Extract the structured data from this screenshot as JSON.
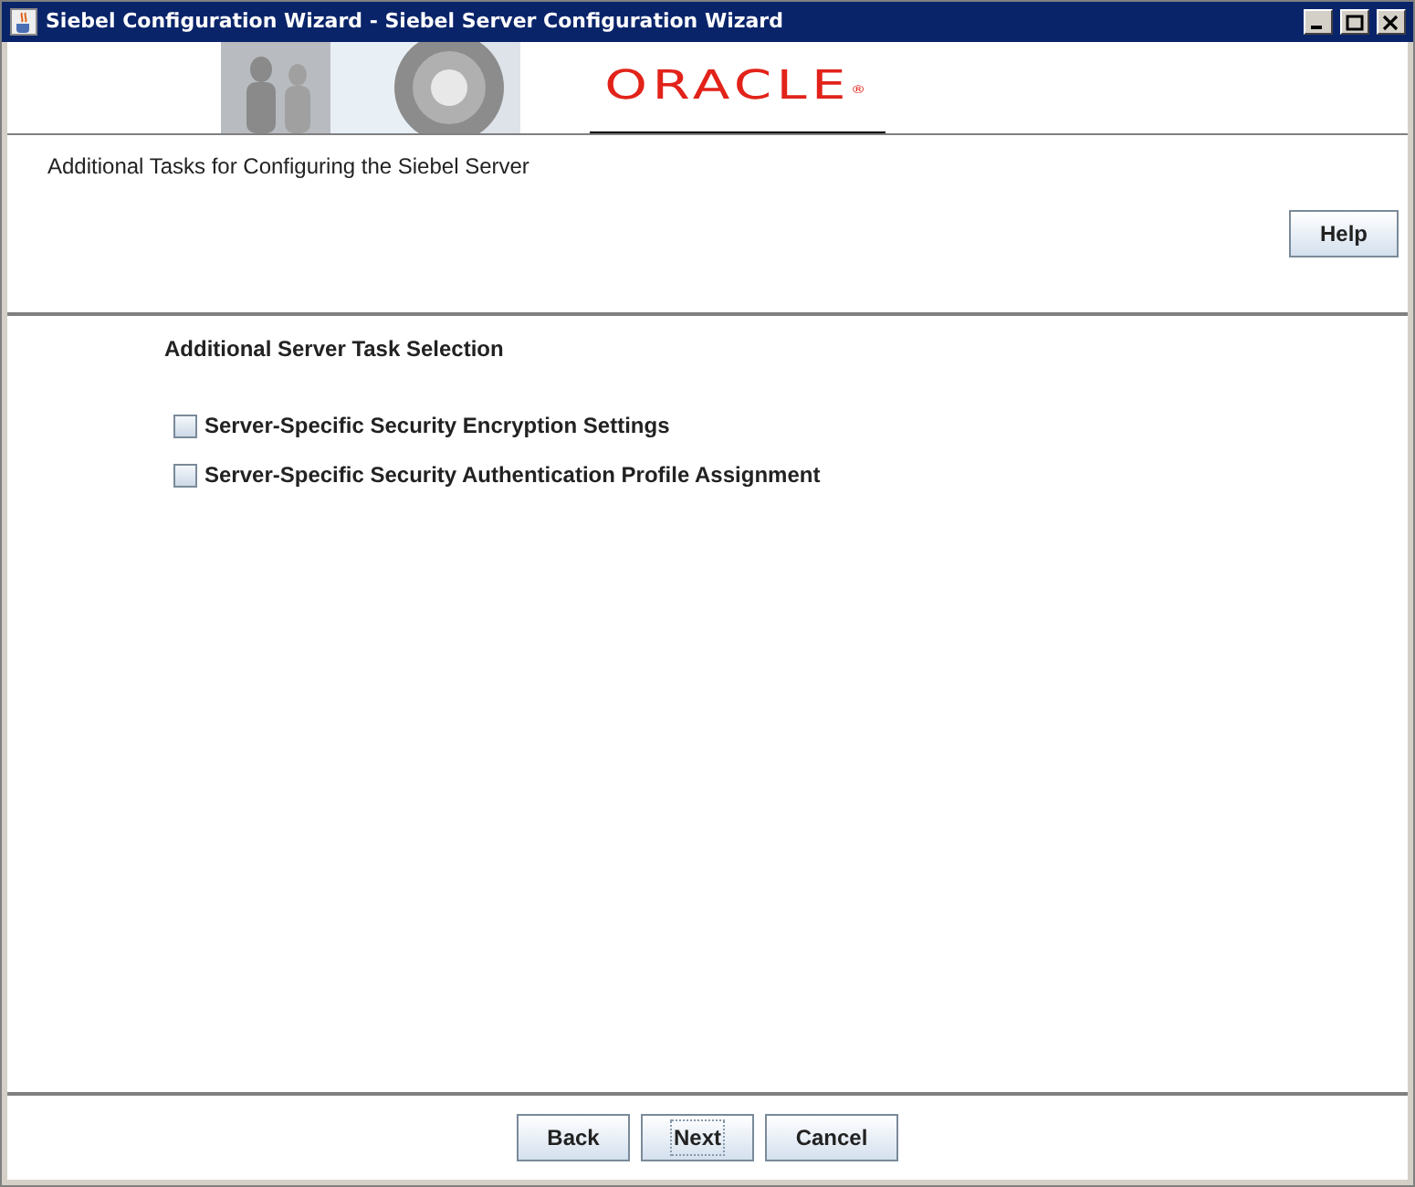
{
  "window": {
    "title": "Siebel Configuration Wizard - Siebel Server Configuration Wizard"
  },
  "banner": {
    "logo": "ORACLE",
    "logo_mark": "®"
  },
  "header": {
    "title": "Additional Tasks for Configuring the Siebel Server",
    "help_button": "Help"
  },
  "content": {
    "section_title": "Additional Server Task Selection",
    "options": [
      {
        "label": "Server-Specific Security Encryption Settings",
        "checked": false
      },
      {
        "label": "Server-Specific Security Authentication Profile Assignment",
        "checked": false
      }
    ]
  },
  "buttons": [
    {
      "label": "Back",
      "focused": false
    },
    {
      "label": "Next",
      "focused": true
    },
    {
      "label": "Cancel",
      "focused": false
    }
  ]
}
